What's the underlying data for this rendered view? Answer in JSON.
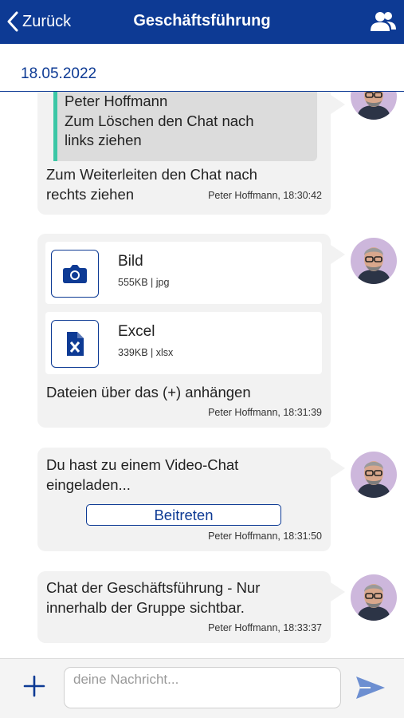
{
  "header": {
    "back_label": "Zurück",
    "title": "Geschäftsführung",
    "back_icon": "chevron-left-icon",
    "group_icon": "users-icon"
  },
  "date_label": "18.05.2022",
  "colors": {
    "primary": "#0d3a94",
    "bubble": "#f2f2f2",
    "quote_bar": "#3cc7a6",
    "avatar_bg": "#cdb7dc"
  },
  "messages": [
    {
      "quote": {
        "author": "Peter Hoffmann",
        "line1": "Zum Löschen den Chat nach",
        "line2": "links ziehen"
      },
      "text_line1": "Zum Weiterleiten den Chat nach",
      "text_line2": "rechts ziehen",
      "meta": "Peter Hoffmann, 18:30:42"
    },
    {
      "files": [
        {
          "name": "Bild",
          "info": "555KB | jpg",
          "icon": "camera-icon"
        },
        {
          "name": "Excel",
          "info": "339KB | xlsx",
          "icon": "excel-file-icon"
        }
      ],
      "text": "Dateien über das (+) anhängen",
      "meta": "Peter Hoffmann, 18:31:39"
    },
    {
      "text_line1": "Du hast zu einem Video-Chat",
      "text_line2": "eingeladen...",
      "button_label": "Beitreten",
      "meta": "Peter Hoffmann, 18:31:50"
    },
    {
      "text_line1": "Chat der Geschäftsführung - Nur",
      "text_line2": "innerhalb der Gruppe sichtbar.",
      "meta": "Peter Hoffmann, 18:33:37"
    }
  ],
  "composer": {
    "placeholder": "deine Nachricht...",
    "plus_icon": "plus-icon",
    "send_icon": "send-icon"
  }
}
